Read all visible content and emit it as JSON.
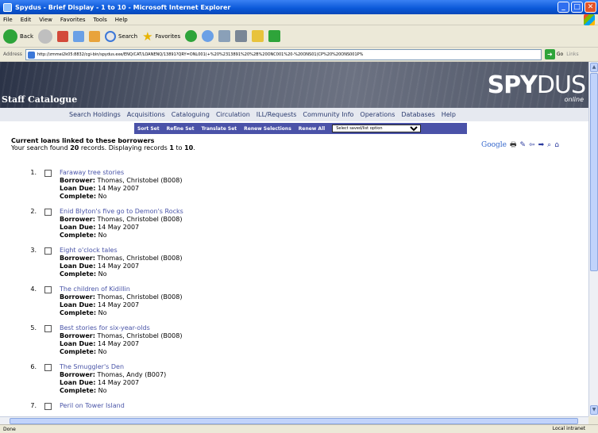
{
  "window": {
    "title": "Spydus - Brief Display - 1 to 10 - Microsoft Internet Explorer",
    "minimize": "_",
    "maximize": "□",
    "close": "✕"
  },
  "menu": [
    "File",
    "Edit",
    "View",
    "Favorites",
    "Tools",
    "Help"
  ],
  "toolbar": {
    "back": "Back",
    "search": "Search",
    "favorites": "Favorites"
  },
  "address": {
    "label": "Address",
    "url": "http://zmmei2k05:8832/cgi-bin/spydus.exe/ENQ/CAT/LOANENQ/13891?QRY=ONL001(+%20%2313891%20%2B%20ONC001%20-%20ONS01)CP%20%20ONS001P%",
    "go": "Go",
    "links": "Links"
  },
  "banner": {
    "staff": "Staff Catalogue",
    "logo_bold": "SPY",
    "logo_light": "DUS",
    "online": "online"
  },
  "nav": [
    "Search Holdings",
    "Acquisitions",
    "Cataloguing",
    "Circulation",
    "ILL/Requests",
    "Community Info",
    "Operations",
    "Databases",
    "Help"
  ],
  "actions": [
    "Sort Set",
    "Refine Set",
    "Translate Set",
    "Renew Selections",
    "Renew All"
  ],
  "actions_select": "Select saved/list option",
  "results": {
    "heading": "Current loans linked to these borrowers",
    "summary_pre": "Your search found ",
    "total": "20",
    "summary_mid": " records. Displaying records ",
    "from": "1",
    "summary_to": " to ",
    "to": "10",
    "summary_end": "."
  },
  "tools": {
    "google": "Google"
  },
  "labels": {
    "borrower": "Borrower:",
    "loan_due": "Loan Due:",
    "complete": "Complete:"
  },
  "items": [
    {
      "num": "1.",
      "title": "Faraway tree stories",
      "borrower": "Thomas, Christobel (B008)",
      "due": "14 May 2007",
      "complete": "No"
    },
    {
      "num": "2.",
      "title": "Enid Blyton's five go to Demon's Rocks",
      "borrower": "Thomas, Christobel (B008)",
      "due": "14 May 2007",
      "complete": "No"
    },
    {
      "num": "3.",
      "title": "Eight o'clock tales",
      "borrower": "Thomas, Christobel (B008)",
      "due": "14 May 2007",
      "complete": "No"
    },
    {
      "num": "4.",
      "title": "The children of Kidillin",
      "borrower": "Thomas, Christobel (B008)",
      "due": "14 May 2007",
      "complete": "No"
    },
    {
      "num": "5.",
      "title": "Best stories for six-year-olds",
      "borrower": "Thomas, Christobel (B008)",
      "due": "14 May 2007",
      "complete": "No"
    },
    {
      "num": "6.",
      "title": "The Smuggler's Den",
      "borrower": "Thomas, Andy (B007)",
      "due": "14 May 2007",
      "complete": "No"
    },
    {
      "num": "7.",
      "title": "Peril on Tower Island",
      "borrower": "",
      "due": "",
      "complete": ""
    }
  ],
  "status": {
    "left": "Done",
    "right": "Local intranet"
  }
}
